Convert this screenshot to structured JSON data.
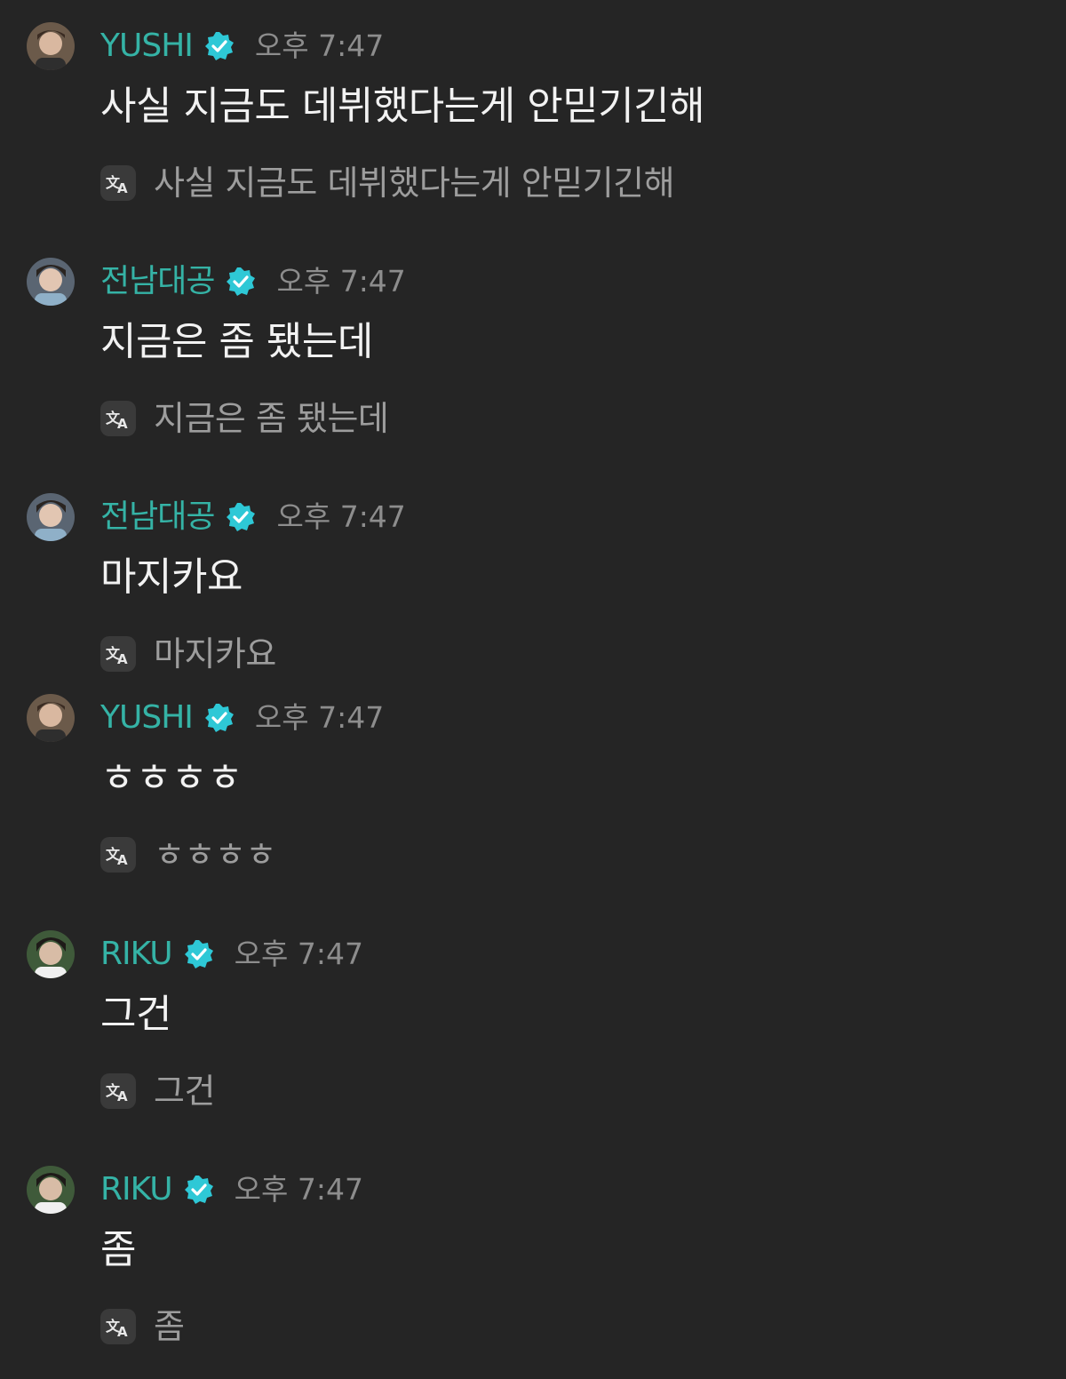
{
  "colors": {
    "background": "#252525",
    "username": "#35b3a6",
    "verified_badge": "#2ec8d6",
    "timestamp": "#8d8d8d",
    "message_text": "#f2f2f2",
    "translation_text": "#9d9d9d"
  },
  "icons": {
    "verified": "verified-badge-icon",
    "translate": "translate-icon"
  },
  "messages": [
    {
      "author": "YUSHI",
      "avatar": "yushi-avatar",
      "time": "오후 7:47",
      "text": "사실 지금도 데뷔했다는게 안믿기긴해",
      "translation": "사실 지금도 데뷔했다는게 안믿기긴해"
    },
    {
      "author": "전남대공",
      "avatar": "jeonnamdaegong-avatar",
      "time": "오후 7:47",
      "text": "지금은 좀 됐는데",
      "translation": "지금은 좀 됐는데"
    },
    {
      "author": "전남대공",
      "avatar": "jeonnamdaegong-avatar",
      "time": "오후 7:47",
      "text": "마지카요",
      "translation": "마지카요"
    },
    {
      "author": "YUSHI",
      "avatar": "yushi-avatar",
      "time": "오후 7:47",
      "text": "ㅎㅎㅎㅎ",
      "translation": "ㅎㅎㅎㅎ"
    },
    {
      "author": "RIKU",
      "avatar": "riku-avatar",
      "time": "오후 7:47",
      "text": "그건",
      "translation": "그건"
    },
    {
      "author": "RIKU",
      "avatar": "riku-avatar",
      "time": "오후 7:47",
      "text": "좀",
      "translation": "좀"
    }
  ]
}
